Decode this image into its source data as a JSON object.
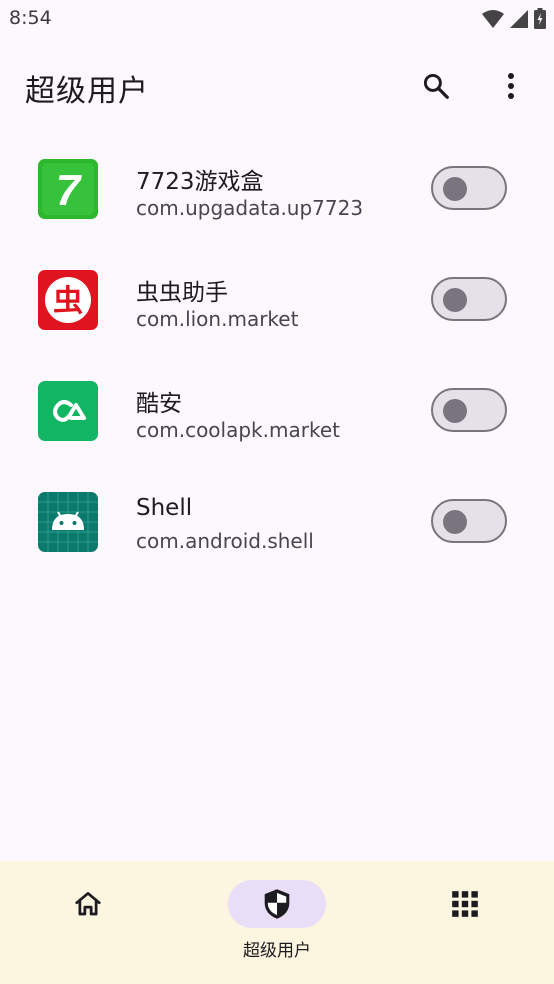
{
  "status_bar": {
    "time": "8:54"
  },
  "app_bar": {
    "title": "超级用户"
  },
  "apps": [
    {
      "name": "7723游戏盒",
      "package": "com.upgadata.up7723",
      "enabled": false
    },
    {
      "name": "虫虫助手",
      "package": "com.lion.market",
      "enabled": false
    },
    {
      "name": "酷安",
      "package": "com.coolapk.market",
      "enabled": false
    },
    {
      "name": "Shell",
      "package": "com.android.shell",
      "enabled": false
    }
  ],
  "icon_glyphs": {
    "app0": "7",
    "app1": "虫"
  },
  "bottom_nav": {
    "items": [
      {
        "label": "",
        "icon": "home-icon"
      },
      {
        "label": "超级用户",
        "icon": "shield-icon",
        "active": true
      },
      {
        "label": "",
        "icon": "apps-grid-icon"
      }
    ]
  },
  "colors": {
    "background": "#fdf8fd",
    "nav_background": "#fcf5df",
    "nav_active": "#e8def8",
    "toggle_track": "#e6e0e9",
    "toggle_outline": "#79747e"
  }
}
